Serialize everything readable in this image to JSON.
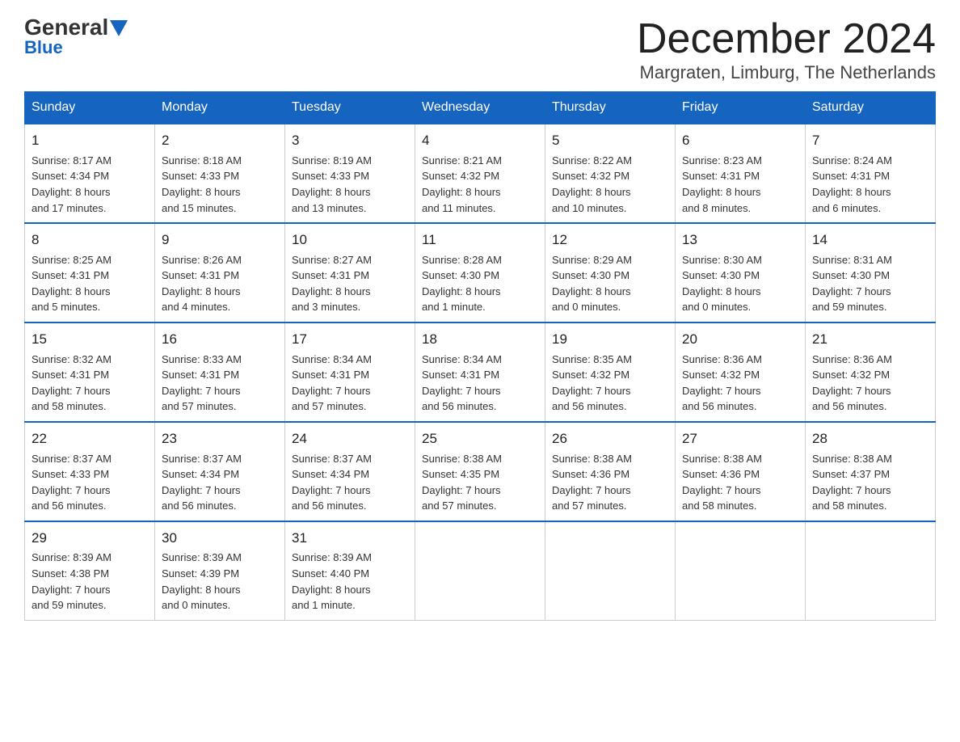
{
  "header": {
    "logo_general": "General",
    "logo_blue": "Blue",
    "month_title": "December 2024",
    "location": "Margraten, Limburg, The Netherlands"
  },
  "days_of_week": [
    "Sunday",
    "Monday",
    "Tuesday",
    "Wednesday",
    "Thursday",
    "Friday",
    "Saturday"
  ],
  "weeks": [
    [
      {
        "day": "1",
        "info": "Sunrise: 8:17 AM\nSunset: 4:34 PM\nDaylight: 8 hours\nand 17 minutes."
      },
      {
        "day": "2",
        "info": "Sunrise: 8:18 AM\nSunset: 4:33 PM\nDaylight: 8 hours\nand 15 minutes."
      },
      {
        "day": "3",
        "info": "Sunrise: 8:19 AM\nSunset: 4:33 PM\nDaylight: 8 hours\nand 13 minutes."
      },
      {
        "day": "4",
        "info": "Sunrise: 8:21 AM\nSunset: 4:32 PM\nDaylight: 8 hours\nand 11 minutes."
      },
      {
        "day": "5",
        "info": "Sunrise: 8:22 AM\nSunset: 4:32 PM\nDaylight: 8 hours\nand 10 minutes."
      },
      {
        "day": "6",
        "info": "Sunrise: 8:23 AM\nSunset: 4:31 PM\nDaylight: 8 hours\nand 8 minutes."
      },
      {
        "day": "7",
        "info": "Sunrise: 8:24 AM\nSunset: 4:31 PM\nDaylight: 8 hours\nand 6 minutes."
      }
    ],
    [
      {
        "day": "8",
        "info": "Sunrise: 8:25 AM\nSunset: 4:31 PM\nDaylight: 8 hours\nand 5 minutes."
      },
      {
        "day": "9",
        "info": "Sunrise: 8:26 AM\nSunset: 4:31 PM\nDaylight: 8 hours\nand 4 minutes."
      },
      {
        "day": "10",
        "info": "Sunrise: 8:27 AM\nSunset: 4:31 PM\nDaylight: 8 hours\nand 3 minutes."
      },
      {
        "day": "11",
        "info": "Sunrise: 8:28 AM\nSunset: 4:30 PM\nDaylight: 8 hours\nand 1 minute."
      },
      {
        "day": "12",
        "info": "Sunrise: 8:29 AM\nSunset: 4:30 PM\nDaylight: 8 hours\nand 0 minutes."
      },
      {
        "day": "13",
        "info": "Sunrise: 8:30 AM\nSunset: 4:30 PM\nDaylight: 8 hours\nand 0 minutes."
      },
      {
        "day": "14",
        "info": "Sunrise: 8:31 AM\nSunset: 4:30 PM\nDaylight: 7 hours\nand 59 minutes."
      }
    ],
    [
      {
        "day": "15",
        "info": "Sunrise: 8:32 AM\nSunset: 4:31 PM\nDaylight: 7 hours\nand 58 minutes."
      },
      {
        "day": "16",
        "info": "Sunrise: 8:33 AM\nSunset: 4:31 PM\nDaylight: 7 hours\nand 57 minutes."
      },
      {
        "day": "17",
        "info": "Sunrise: 8:34 AM\nSunset: 4:31 PM\nDaylight: 7 hours\nand 57 minutes."
      },
      {
        "day": "18",
        "info": "Sunrise: 8:34 AM\nSunset: 4:31 PM\nDaylight: 7 hours\nand 56 minutes."
      },
      {
        "day": "19",
        "info": "Sunrise: 8:35 AM\nSunset: 4:32 PM\nDaylight: 7 hours\nand 56 minutes."
      },
      {
        "day": "20",
        "info": "Sunrise: 8:36 AM\nSunset: 4:32 PM\nDaylight: 7 hours\nand 56 minutes."
      },
      {
        "day": "21",
        "info": "Sunrise: 8:36 AM\nSunset: 4:32 PM\nDaylight: 7 hours\nand 56 minutes."
      }
    ],
    [
      {
        "day": "22",
        "info": "Sunrise: 8:37 AM\nSunset: 4:33 PM\nDaylight: 7 hours\nand 56 minutes."
      },
      {
        "day": "23",
        "info": "Sunrise: 8:37 AM\nSunset: 4:34 PM\nDaylight: 7 hours\nand 56 minutes."
      },
      {
        "day": "24",
        "info": "Sunrise: 8:37 AM\nSunset: 4:34 PM\nDaylight: 7 hours\nand 56 minutes."
      },
      {
        "day": "25",
        "info": "Sunrise: 8:38 AM\nSunset: 4:35 PM\nDaylight: 7 hours\nand 57 minutes."
      },
      {
        "day": "26",
        "info": "Sunrise: 8:38 AM\nSunset: 4:36 PM\nDaylight: 7 hours\nand 57 minutes."
      },
      {
        "day": "27",
        "info": "Sunrise: 8:38 AM\nSunset: 4:36 PM\nDaylight: 7 hours\nand 58 minutes."
      },
      {
        "day": "28",
        "info": "Sunrise: 8:38 AM\nSunset: 4:37 PM\nDaylight: 7 hours\nand 58 minutes."
      }
    ],
    [
      {
        "day": "29",
        "info": "Sunrise: 8:39 AM\nSunset: 4:38 PM\nDaylight: 7 hours\nand 59 minutes."
      },
      {
        "day": "30",
        "info": "Sunrise: 8:39 AM\nSunset: 4:39 PM\nDaylight: 8 hours\nand 0 minutes."
      },
      {
        "day": "31",
        "info": "Sunrise: 8:39 AM\nSunset: 4:40 PM\nDaylight: 8 hours\nand 1 minute."
      },
      {
        "day": "",
        "info": ""
      },
      {
        "day": "",
        "info": ""
      },
      {
        "day": "",
        "info": ""
      },
      {
        "day": "",
        "info": ""
      }
    ]
  ]
}
